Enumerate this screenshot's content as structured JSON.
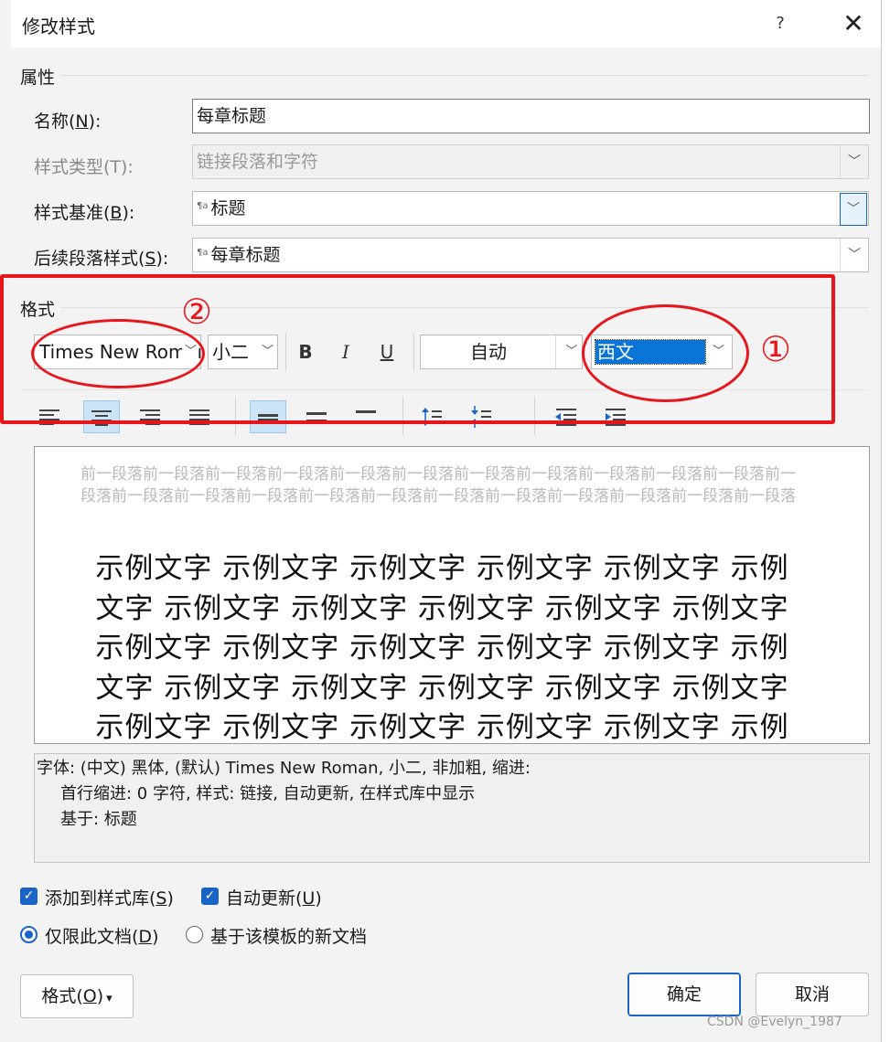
{
  "dialog": {
    "title": "修改样式",
    "help": "?",
    "close": "✕"
  },
  "properties": {
    "section": "属性",
    "name_label_pre": "名称(",
    "name_label_key": "N",
    "name_label_post": "):",
    "name_value": "每章标题",
    "type_label": "样式类型(T):",
    "type_value": "链接段落和字符",
    "base_label_pre": "样式基准(",
    "base_label_key": "B",
    "base_label_post": "):",
    "base_value": "标题",
    "next_label_pre": "后续段落样式(",
    "next_label_key": "S",
    "next_label_post": "):",
    "next_value": "每章标题",
    "para_glyph": "¶a"
  },
  "format": {
    "section": "格式",
    "font_name": "Times New Roman",
    "font_size": "小二",
    "bold": "B",
    "italic": "I",
    "underline": "U",
    "color": "自动",
    "script": "西文"
  },
  "annotations": {
    "one": "①",
    "two": "②",
    "color": "#e8151b"
  },
  "preview": {
    "prev_para": "前一段落前一段落前一段落前一段落前一段落前一段落前一段落前一段落前一段落前一段落前一段落前一段落前一段落前一段落前一段落前一段落前一段落前一段落前一段落前一段落前一段落前一段落前一段落",
    "sample": "示例文字 示例文字 示例文字 示例文字 示例文字 示例文字 示例文字 示例文字 示例文字 示例文字 示例文字 示例文字 示例文字 示例文字 示例文字 示例文字 示例文字 示例文字 示例文字 示例文字 示例文字 示例文字 示例文字 示例文字 示例文字 示例文字 示例文字 示例文字"
  },
  "description": {
    "line1": "字体: (中文) 黑体, (默认) Times New Roman, 小二, 非加粗, 缩进:",
    "line2": "首行缩进:  0 字符, 样式: 链接, 自动更新, 在样式库中显示",
    "line3": "基于: 标题"
  },
  "options": {
    "add_gallery_pre": "添加到样式库(",
    "add_gallery_key": "S",
    "add_gallery_post": ")",
    "auto_update_pre": "自动更新(",
    "auto_update_key": "U",
    "auto_update_post": ")",
    "only_doc_pre": "仅限此文档(",
    "only_doc_key": "D",
    "only_doc_post": ")",
    "new_docs": "基于该模板的新文档",
    "check_mark": "✓"
  },
  "buttons": {
    "format_pre": "格式(",
    "format_key": "O",
    "format_post": ")",
    "format_caret": "▾",
    "ok": "确定",
    "cancel": "取消"
  },
  "watermark": "CSDN @Evelyn_1987",
  "colors": {
    "accent": "#1a64c8",
    "selection": "#0b74d7",
    "annotation": "#e8151b"
  }
}
